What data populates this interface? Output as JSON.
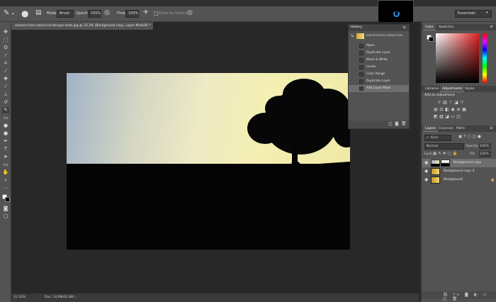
{
  "options_bar": {
    "mode_label": "Mode:",
    "mode_value": "Brush",
    "opacity_label": "Opacity:",
    "opacity_value": "100%",
    "flow_label": "Flow:",
    "flow_value": "100%",
    "erase_history_label": "Erase to History",
    "workspace": "Essentials"
  },
  "document": {
    "tab_title": "autumn-tree-nature-landscape-wide.jpg @ 33.3% (Background copy, Layer Mask/8) *"
  },
  "status_bar": {
    "zoom": "33.33%",
    "doc_size": "Doc: 14.8M/42.8M"
  },
  "history_panel": {
    "title": "History",
    "snapshot": "autumn-tree-nature-lan...",
    "items": [
      "Open",
      "Duplicate Layer",
      "Black & White",
      "Levels",
      "Color Range",
      "Duplicate Layer",
      "Add Layer Mask"
    ],
    "selected_index": 6
  },
  "color_panel": {
    "tabs": [
      "Color",
      "Swatches"
    ],
    "accent": "#d62b2b"
  },
  "adjustments_panel": {
    "tabs": [
      "Libraries",
      "Adjustments",
      "Styles"
    ],
    "heading": "Add an adjustment"
  },
  "layers_panel": {
    "tabs": [
      "Layers",
      "Channels",
      "Paths"
    ],
    "kind_label": "Kind",
    "blend_mode": "Normal",
    "opacity_label": "Opacity:",
    "opacity_value": "100%",
    "lock_label": "Lock:",
    "fill_label": "Fill:",
    "fill_value": "100%",
    "layers": [
      {
        "name": "Background copy"
      },
      {
        "name": "Background copy 2"
      },
      {
        "name": "Background"
      }
    ]
  }
}
